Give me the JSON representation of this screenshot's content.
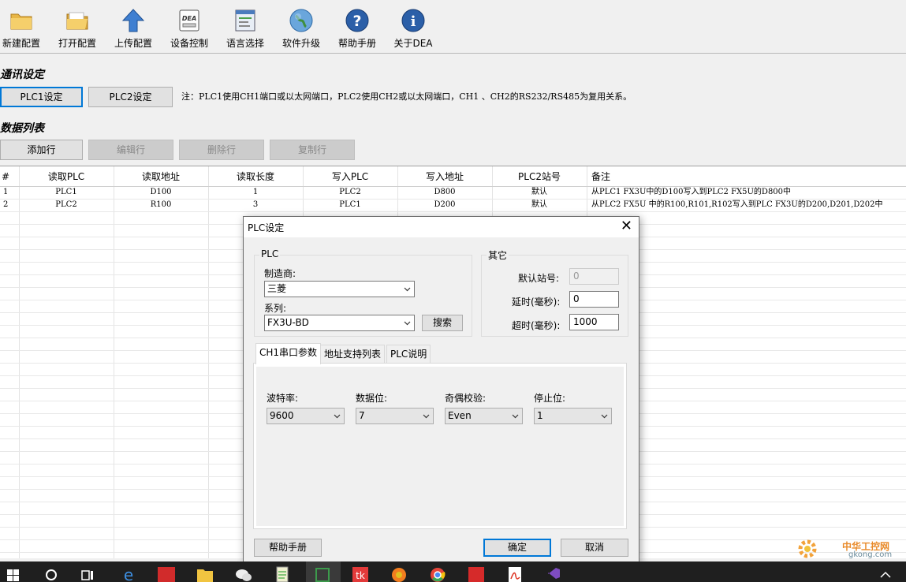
{
  "toolbar": {
    "items": [
      {
        "label": "新建配置",
        "icon": "folder-new-icon"
      },
      {
        "label": "打开配置",
        "icon": "folder-open-icon"
      },
      {
        "label": "上传配置",
        "icon": "upload-arrow-icon"
      },
      {
        "label": "设备控制",
        "icon": "dea-device-icon"
      },
      {
        "label": "语言选择",
        "icon": "language-window-icon"
      },
      {
        "label": "软件升级",
        "icon": "globe-icon"
      },
      {
        "label": "帮助手册",
        "icon": "help-icon"
      },
      {
        "label": "关于DEA",
        "icon": "info-icon"
      }
    ]
  },
  "comm": {
    "title": "通讯设定",
    "plc1_button": "PLC1设定",
    "plc2_button": "PLC2设定",
    "note": "注：PLC1使用CH1端口或以太网端口，PLC2使用CH2或以太网端口，CH1 、CH2的RS232/RS485为复用关系。"
  },
  "datalist": {
    "title": "数据列表",
    "buttons": {
      "add": "添加行",
      "edit": "编辑行",
      "delete": "删除行",
      "copy": "复制行"
    },
    "columns": [
      "#",
      "读取PLC",
      "读取地址",
      "读取长度",
      "写入PLC",
      "写入地址",
      "PLC2站号",
      "备注"
    ],
    "rows": [
      [
        "1",
        "PLC1",
        "D100",
        "1",
        "PLC2",
        "D800",
        "默认",
        "从PLC1 FX3U中的D100写入到PLC2 FX5U的D800中"
      ],
      [
        "2",
        "PLC2",
        "R100",
        "3",
        "PLC1",
        "D200",
        "默认",
        "从PLC2  FX5U 中的R100,R101,R102写入到PLC FX3U的D200,D201,D202中"
      ]
    ]
  },
  "dialog": {
    "title": "PLC设定",
    "plc_group": "PLC",
    "manufacturer_label": "制造商:",
    "manufacturer_value": "三菱",
    "series_label": "系列:",
    "series_value": "FX3U-BD",
    "search_button": "搜索",
    "other_group": "其它",
    "default_station_label": "默认站号:",
    "default_station_value": "0",
    "delay_label": "延时(毫秒):",
    "delay_value": "0",
    "timeout_label": "超时(毫秒):",
    "timeout_value": "1000",
    "tabs": [
      "CH1串口参数",
      "地址支持列表",
      "PLC说明"
    ],
    "serial": {
      "baud_label": "波特率:",
      "baud_value": "9600",
      "databits_label": "数据位:",
      "databits_value": "7",
      "parity_label": "奇偶校验:",
      "parity_value": "Even",
      "stopbits_label": "停止位:",
      "stopbits_value": "1"
    },
    "help_button": "帮助手册",
    "ok_button": "确定",
    "cancel_button": "取消"
  },
  "watermark": {
    "text": "中华工控网",
    "url": "gkong.com"
  },
  "colors": {
    "accent": "#0078d7",
    "taskbar": "#1f1f1f"
  }
}
